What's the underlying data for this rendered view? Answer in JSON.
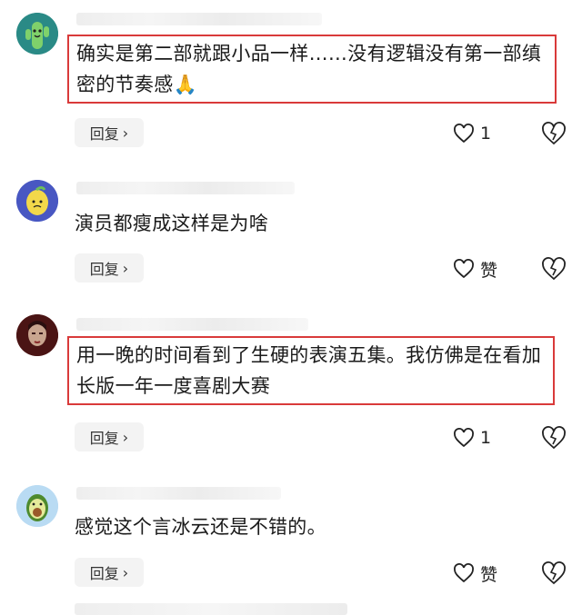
{
  "comments": [
    {
      "text": "确实是第二部就跟小品一样……没有逻辑没有第一部缜密的节奏感🙏",
      "reply_label": "回复",
      "like_label": "1",
      "highlighted": true,
      "avatar": "cactus-avatar"
    },
    {
      "text": "演员都瘦成这样是为啥",
      "reply_label": "回复",
      "like_label": "赞",
      "highlighted": false,
      "avatar": "lemon-avatar"
    },
    {
      "text": "用一晚的时间看到了生硬的表演五集。我仿佛是在看加长版一年一度喜剧大赛",
      "reply_label": "回复",
      "like_label": "1",
      "highlighted": true,
      "avatar": "photo-avatar"
    },
    {
      "text": "感觉这个言冰云还是不错的。",
      "reply_label": "回复",
      "like_label": "赞",
      "highlighted": false,
      "avatar": "avocado-avatar"
    }
  ],
  "colors": {
    "highlight_border": "#d93a3a",
    "reply_bg": "#f3f3f3"
  }
}
